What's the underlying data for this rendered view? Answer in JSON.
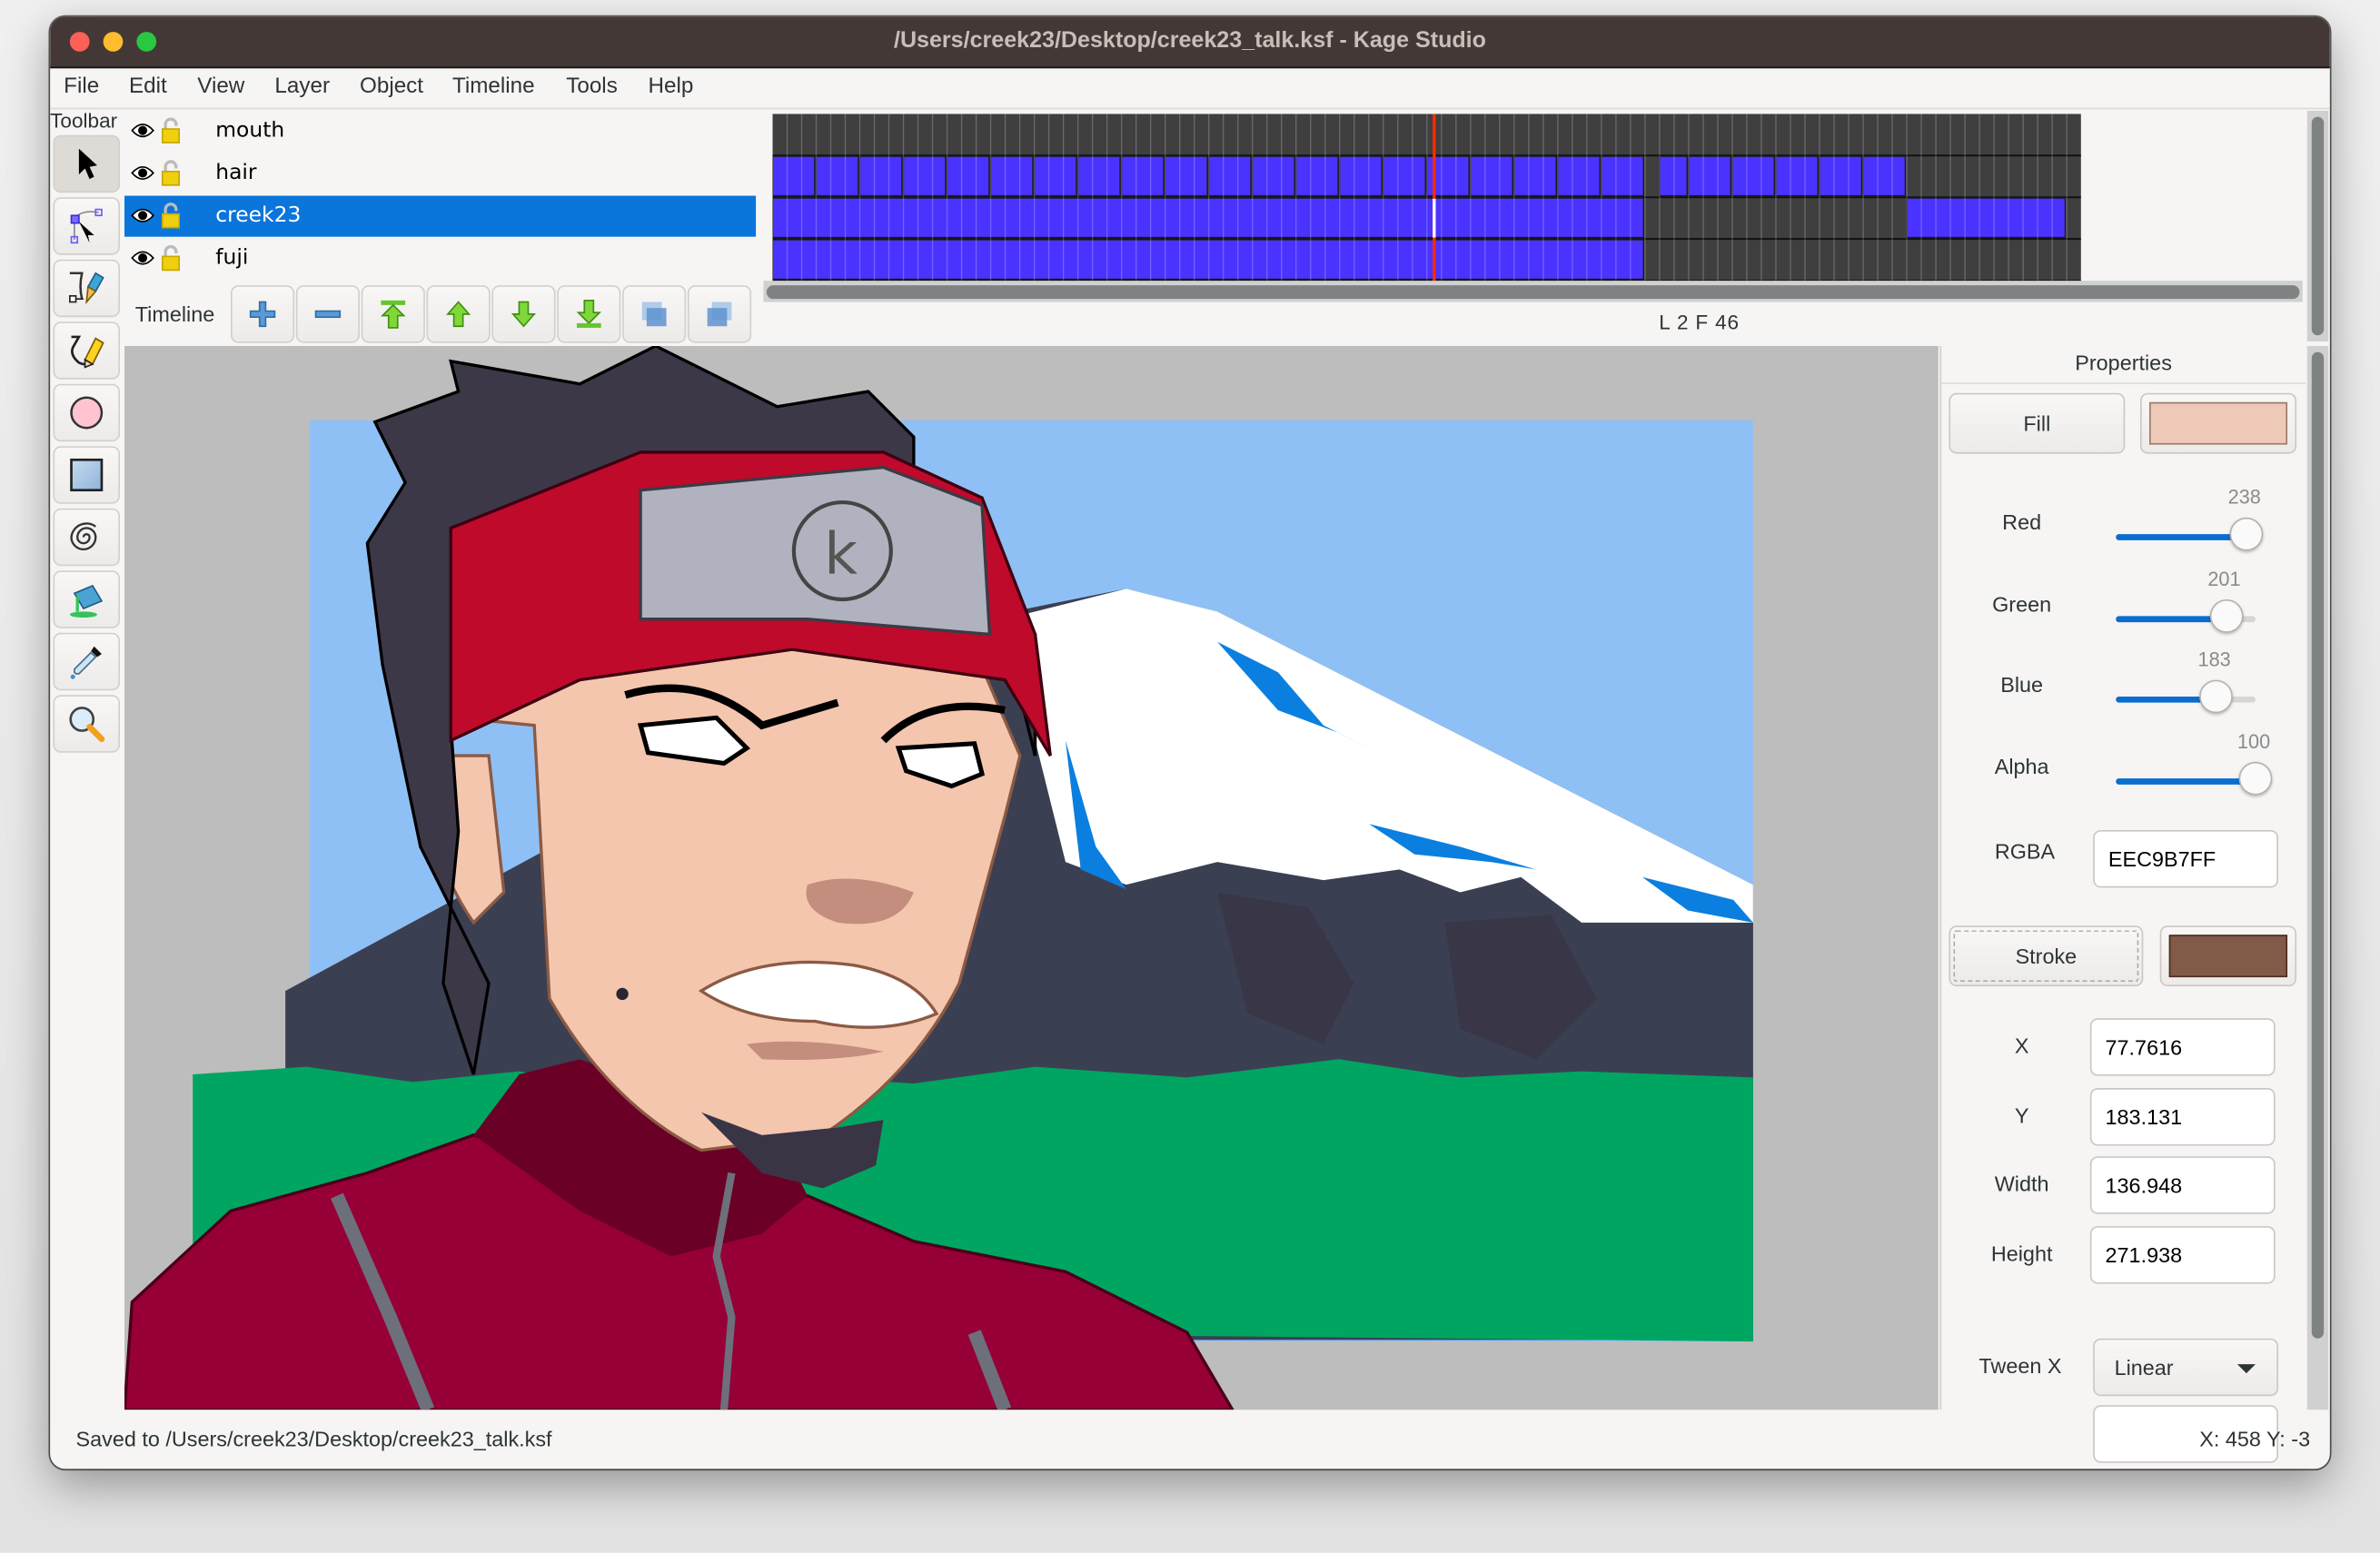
{
  "window": {
    "title": "/Users/creek23/Desktop/creek23_talk.ksf - Kage Studio"
  },
  "menu": [
    "File",
    "Edit",
    "View",
    "Layer",
    "Object",
    "Timeline",
    "Tools",
    "Help"
  ],
  "toolbar": {
    "label": "Toolbar",
    "tools": [
      {
        "name": "select-tool",
        "icon": "arrow-pointer-icon",
        "active": true
      },
      {
        "name": "node-tool",
        "icon": "node-edit-icon",
        "active": false
      },
      {
        "name": "bezier-pen-tool",
        "icon": "pen-icon",
        "active": false
      },
      {
        "name": "pencil-tool",
        "icon": "pencil-icon",
        "active": false
      },
      {
        "name": "oval-tool",
        "icon": "circle-icon",
        "active": false
      },
      {
        "name": "rectangle-tool",
        "icon": "square-icon",
        "active": false
      },
      {
        "name": "spiral-tool",
        "icon": "spiral-icon",
        "active": false
      },
      {
        "name": "fill-tool",
        "icon": "paint-bucket-icon",
        "active": false
      },
      {
        "name": "eyedropper-tool",
        "icon": "eyedropper-icon",
        "active": false
      },
      {
        "name": "zoom-tool",
        "icon": "magnifier-icon",
        "active": false
      }
    ]
  },
  "layers": [
    {
      "name": "mouth",
      "visible": true,
      "locked": false,
      "selected": false
    },
    {
      "name": "hair",
      "visible": true,
      "locked": false,
      "selected": false
    },
    {
      "name": "creek23",
      "visible": true,
      "locked": false,
      "selected": true
    },
    {
      "name": "fuji",
      "visible": true,
      "locked": false,
      "selected": false
    }
  ],
  "timeline": {
    "label": "Timeline",
    "buttons": [
      {
        "name": "add-layer-button",
        "icon": "plus-icon"
      },
      {
        "name": "remove-layer-button",
        "icon": "minus-icon"
      },
      {
        "name": "move-layer-top-button",
        "icon": "arrow-top-icon"
      },
      {
        "name": "move-layer-up-button",
        "icon": "arrow-up-icon"
      },
      {
        "name": "move-layer-down-button",
        "icon": "arrow-down-icon"
      },
      {
        "name": "move-layer-bottom-button",
        "icon": "arrow-bottom-icon"
      },
      {
        "name": "onion-skin-before-button",
        "icon": "layers-stack-icon"
      },
      {
        "name": "onion-skin-after-button",
        "icon": "layers-stack-alt-icon"
      }
    ],
    "total_frames": 90,
    "current_frame": 46,
    "current_layer": 2,
    "status": "L 2 F 46",
    "tracks": [
      {
        "layer": "mouth",
        "blocks": []
      },
      {
        "layer": "hair",
        "blocks": [
          [
            1,
            3
          ],
          [
            4,
            6
          ],
          [
            7,
            9
          ],
          [
            10,
            12
          ],
          [
            13,
            15
          ],
          [
            16,
            18
          ],
          [
            19,
            21
          ],
          [
            22,
            24
          ],
          [
            25,
            27
          ],
          [
            28,
            30
          ],
          [
            31,
            33
          ],
          [
            34,
            36
          ],
          [
            37,
            39
          ],
          [
            40,
            42
          ],
          [
            43,
            45
          ],
          [
            46,
            48
          ],
          [
            49,
            51
          ],
          [
            52,
            54
          ],
          [
            55,
            57
          ],
          [
            58,
            60
          ],
          [
            62,
            63
          ],
          [
            64,
            66
          ],
          [
            67,
            69
          ],
          [
            70,
            72
          ],
          [
            73,
            75
          ],
          [
            76,
            78
          ]
        ]
      },
      {
        "layer": "creek23",
        "blocks": [
          [
            1,
            60
          ],
          [
            79,
            89
          ]
        ]
      },
      {
        "layer": "fuji",
        "blocks": [
          [
            1,
            60
          ]
        ]
      }
    ],
    "colors": {
      "frame_fill": "#4b33ff",
      "empty": "#3f3f3f",
      "playhead": "#ff2a00"
    }
  },
  "properties": {
    "title": "Properties",
    "fill_label": "Fill",
    "fill_color": "#EEC9B7",
    "sliders": [
      {
        "label": "Red",
        "value": 238,
        "max": 255
      },
      {
        "label": "Green",
        "value": 201,
        "max": 255
      },
      {
        "label": "Blue",
        "value": 183,
        "max": 255
      },
      {
        "label": "Alpha",
        "value": 100,
        "max": 100
      }
    ],
    "rgba_label": "RGBA",
    "rgba_value": "EEC9B7FF",
    "stroke_label": "Stroke",
    "stroke_color": "#815A48",
    "x_label": "X",
    "x_value": "77.7616",
    "y_label": "Y",
    "y_value": "183.131",
    "width_label": "Width",
    "width_value": "136.948",
    "height_label": "Height",
    "height_value": "271.938",
    "tween_x_label": "Tween X",
    "tween_x_value": "Linear"
  },
  "status": {
    "message": "Saved to /Users/creek23/Desktop/creek23_talk.ksf",
    "cursor": "X: 458 Y: -3"
  }
}
